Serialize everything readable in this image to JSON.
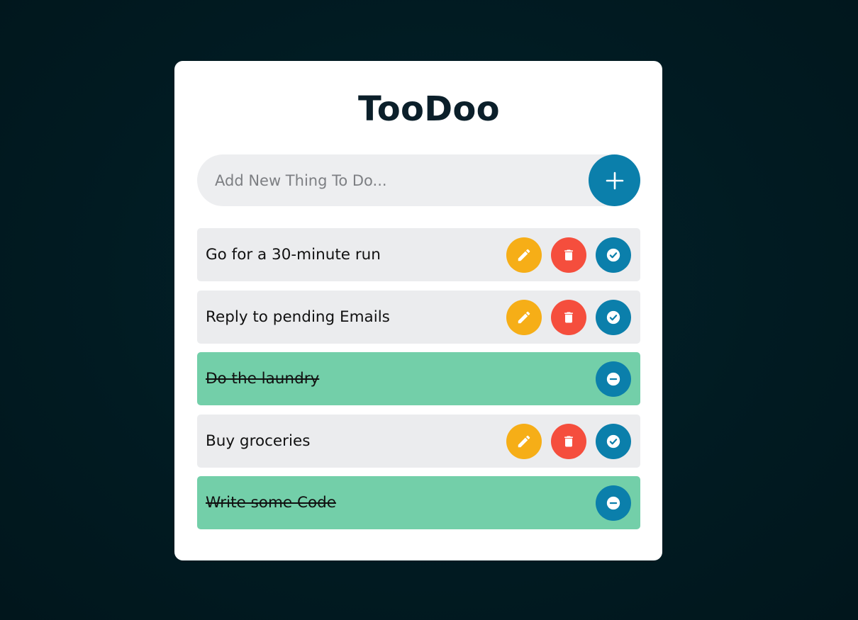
{
  "app": {
    "title": "TooDoo"
  },
  "add_form": {
    "placeholder": "Add New Thing To Do...",
    "value": "",
    "add_icon": "plus-icon"
  },
  "colors": {
    "background": "#011b22",
    "card": "#ffffff",
    "accent_blue": "#0b7fab",
    "edit_yellow": "#f6ae17",
    "delete_red": "#f54e3d",
    "done_green": "#73cfa9",
    "item_gray": "#ebecee"
  },
  "todos": [
    {
      "text": "Go for a 30-minute run",
      "done": false,
      "icons": [
        "pencil-icon",
        "trash-icon",
        "check-circle-icon"
      ]
    },
    {
      "text": "Reply to pending Emails",
      "done": false,
      "icons": [
        "pencil-icon",
        "trash-icon",
        "check-circle-icon"
      ]
    },
    {
      "text": "Do the laundry",
      "done": true,
      "icons": [
        "minus-circle-icon"
      ]
    },
    {
      "text": "Buy groceries",
      "done": false,
      "icons": [
        "pencil-icon",
        "trash-icon",
        "check-circle-icon"
      ]
    },
    {
      "text": "Write some Code",
      "done": true,
      "icons": [
        "minus-circle-icon"
      ]
    }
  ]
}
